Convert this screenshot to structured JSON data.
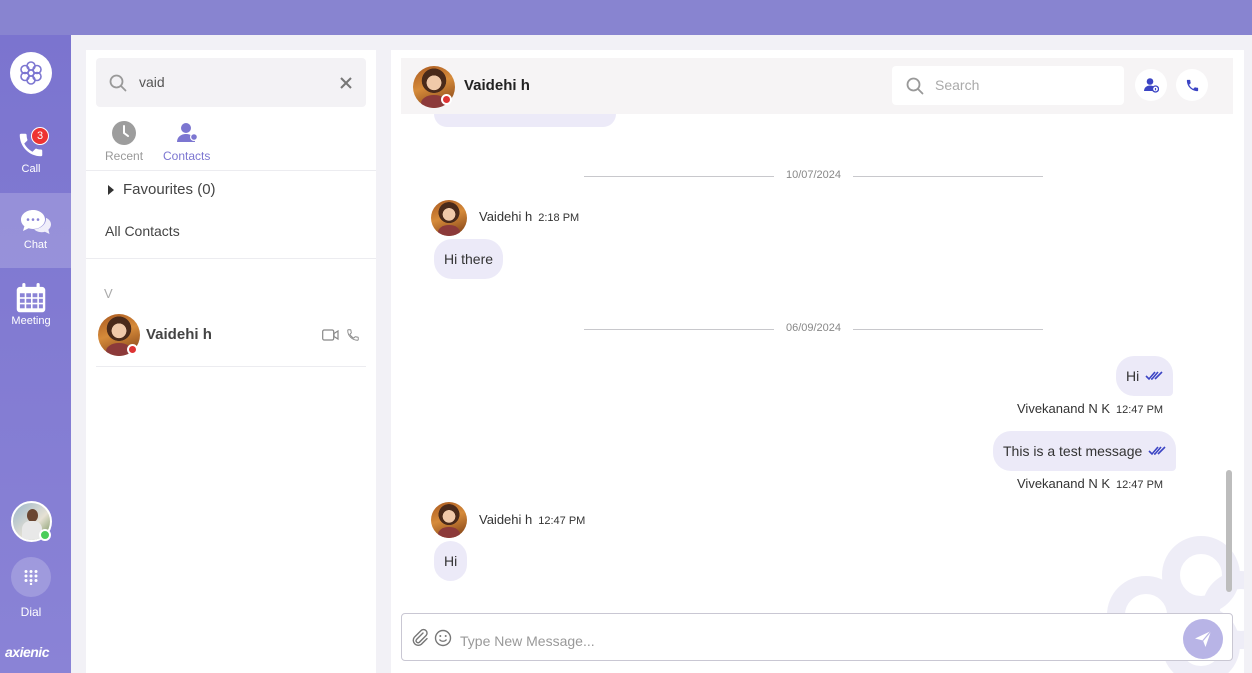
{
  "nav": {
    "call_label": "Call",
    "call_badge": "3",
    "chat_label": "Chat",
    "meeting_label": "Meeting",
    "dial_label": "Dial",
    "brand": "axienic"
  },
  "contacts_panel": {
    "search_value": "vaid",
    "tabs": [
      {
        "label": "Recent",
        "icon": "clock-icon"
      },
      {
        "label": "Contacts",
        "icon": "contacts-icon"
      }
    ],
    "favourites_label": "Favourites (0)",
    "all_contacts_label": "All Contacts",
    "group_letter": "V",
    "contacts": [
      {
        "name": "Vaidehi h",
        "status": "busy"
      }
    ]
  },
  "chat": {
    "contact_name": "Vaidehi h",
    "search_placeholder": "Search",
    "messages": [
      {
        "type": "date",
        "text": "10/07/2024"
      },
      {
        "type": "in",
        "sender": "Vaidehi h",
        "time": "2:18 PM",
        "text": "Hi there"
      },
      {
        "type": "date",
        "text": "06/09/2024"
      },
      {
        "type": "out",
        "sender": "Vivekanand N K",
        "time": "12:47 PM",
        "text": "Hi"
      },
      {
        "type": "out",
        "sender": "Vivekanand N K",
        "time": "12:47 PM",
        "text": "This is a test message"
      },
      {
        "type": "in",
        "sender": "Vaidehi h",
        "time": "12:47 PM",
        "text": "Hi"
      }
    ],
    "composer_placeholder": "Type New Message..."
  },
  "colors": {
    "accent": "#7c76d1",
    "topbar": "#8884d0",
    "bubble": "#eceaf8",
    "online": "#4bcd5b",
    "busy": "#d33333"
  }
}
